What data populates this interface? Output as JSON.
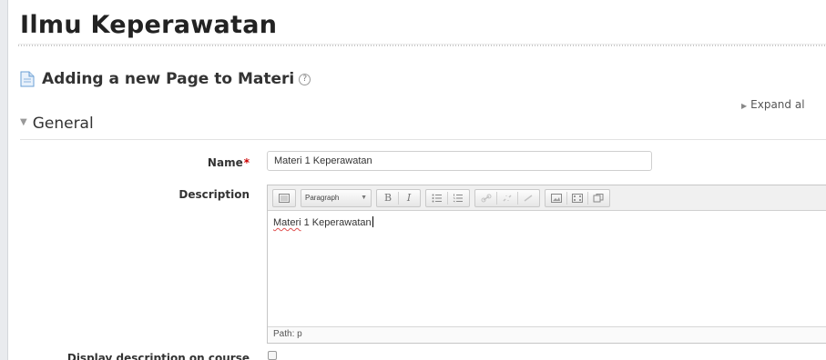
{
  "site": {
    "title": "Ilmu Keperawatan"
  },
  "page": {
    "heading": "Adding a new Page to Materi",
    "help_icon": "?",
    "expand_all": "Expand al"
  },
  "section": {
    "legend": "General"
  },
  "form": {
    "name_label": "Name",
    "name_required_mark": "*",
    "name_value": "Materi 1 Keperawatan",
    "description_label": "Description",
    "description_value_word1": "Materi",
    "description_value_rest": " 1 Keperawatan",
    "display_description_label": "Display description on course"
  },
  "editor": {
    "format_select": "Paragraph",
    "bold_label": "B",
    "italic_label": "I",
    "path": "Path: p"
  },
  "icons": {
    "page": "page-icon",
    "help": "help-icon",
    "expand": "triangle-right-icon",
    "collapse": "chevron-down-icon"
  }
}
